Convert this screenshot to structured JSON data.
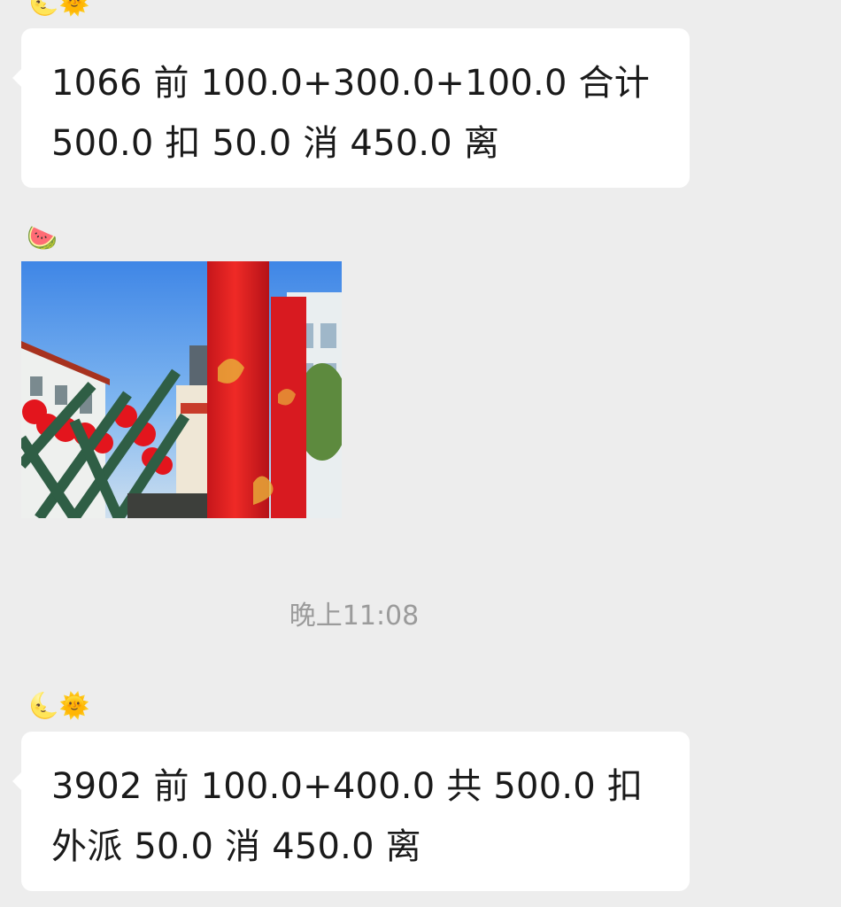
{
  "messages": [
    {
      "sender_emoji": "🌜🌞",
      "lines": [
        "1066 前 100.0+300.0+100.0 合计",
        "500.0 扣 50.0 消 450.0 离"
      ]
    },
    {
      "sender_emoji": "🍉",
      "image_icon": "festival-street-photo"
    },
    {
      "sender_emoji": "🌜🌞",
      "lines": [
        "3902 前 100.0+400.0 共 500.0 扣",
        "外派 50.0 消 450.0 离"
      ]
    }
  ],
  "timestamp": "晚上11:08",
  "colors": {
    "background": "#ededed",
    "bubble": "#ffffff",
    "text": "#1a1a1a",
    "timestamp": "#9b9b9b"
  }
}
